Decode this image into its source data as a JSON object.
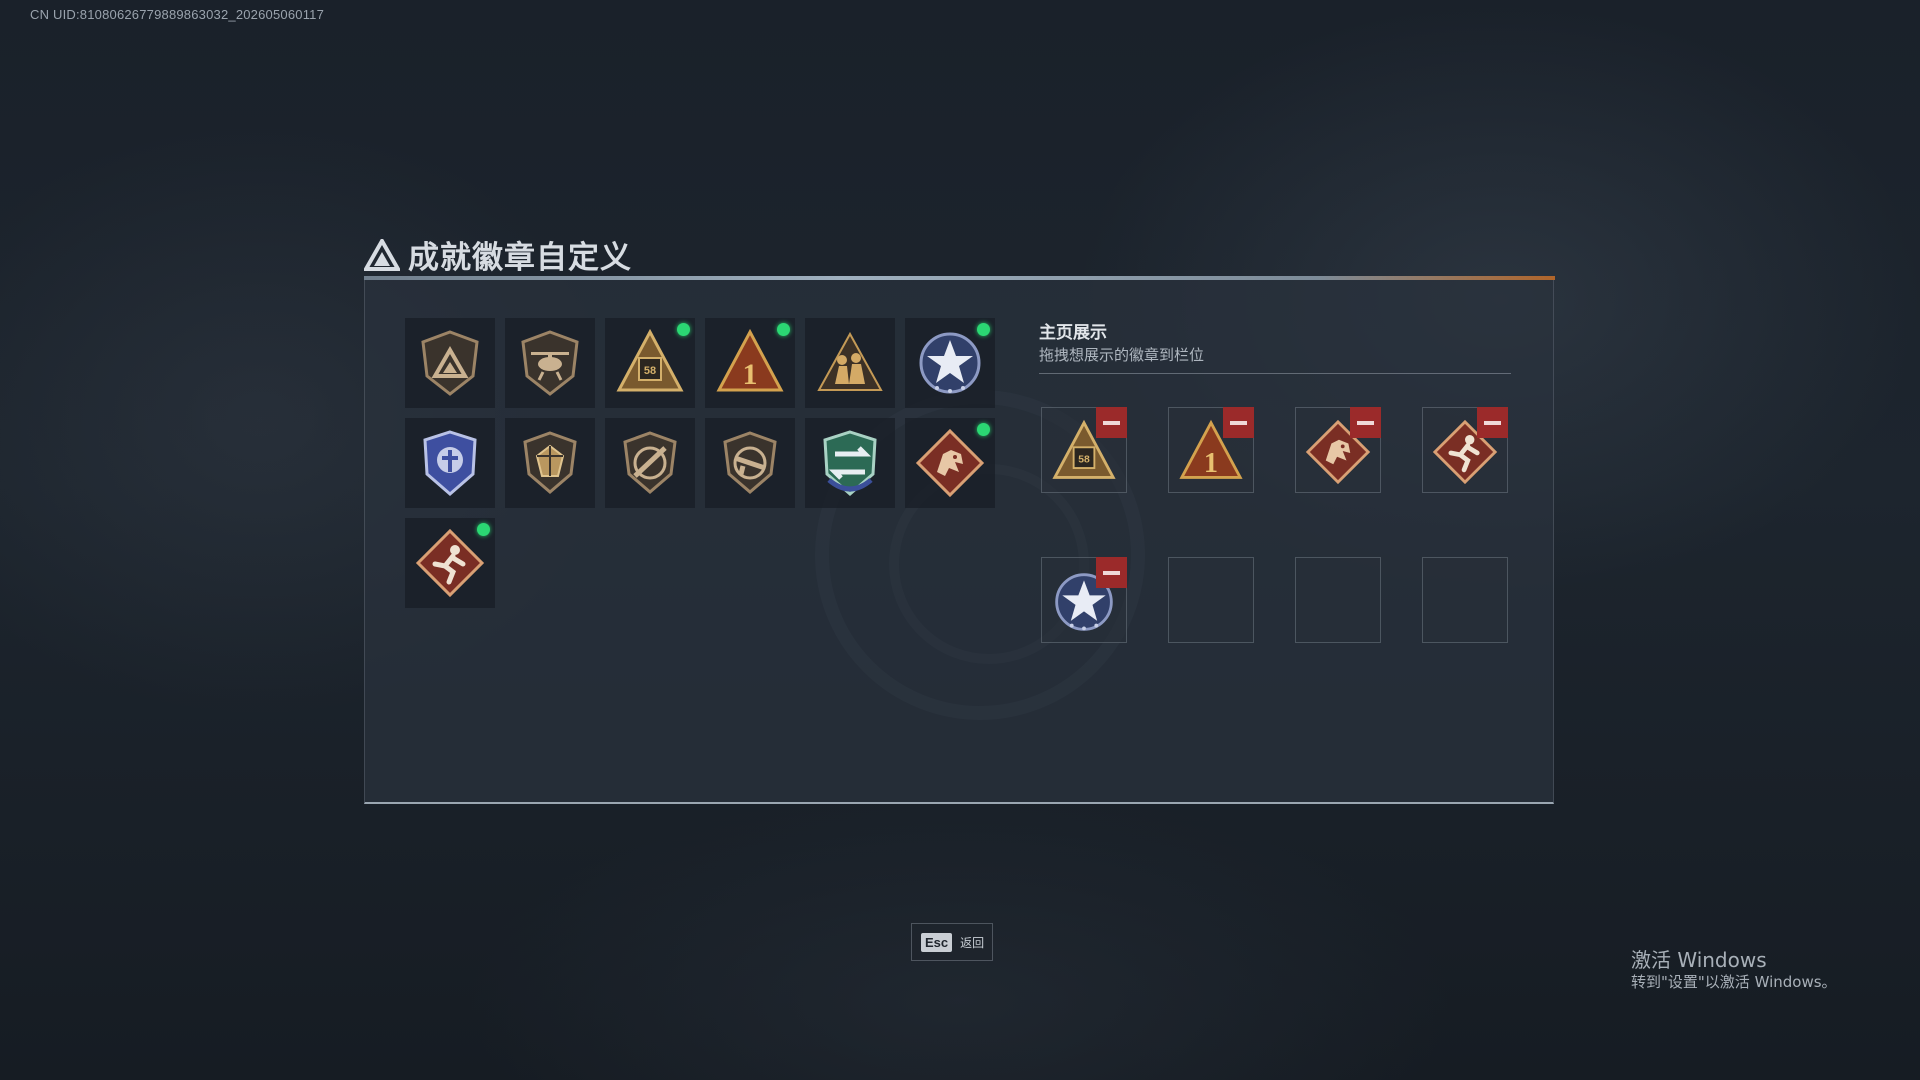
{
  "uid_text": "CN UID:8108062677988986303​2_202605060117",
  "page": {
    "title": "成就徽章自定义"
  },
  "owned_badges": [
    {
      "icon": "triangle-shield-badge-icon",
      "selected": false
    },
    {
      "icon": "helicopter-shield-badge-icon",
      "selected": false
    },
    {
      "icon": "vehicle-triangle-badge-icon",
      "selected": true
    },
    {
      "icon": "number-one-triangle-badge-icon",
      "selected": true
    },
    {
      "icon": "soldiers-triangle-badge-icon",
      "selected": false
    },
    {
      "icon": "star-globe-badge-icon",
      "selected": true
    },
    {
      "icon": "blue-eagle-shield-badge-icon",
      "selected": false
    },
    {
      "icon": "gem-shield-badge-icon",
      "selected": false
    },
    {
      "icon": "crossed-rifle-shield-badge-icon",
      "selected": false
    },
    {
      "icon": "rifle-shield-badge-icon",
      "selected": false
    },
    {
      "icon": "arrows-green-shield-badge-icon",
      "selected": false
    },
    {
      "icon": "dragon-diamond-badge-icon",
      "selected": true
    },
    {
      "icon": "runner-diamond-badge-icon",
      "selected": true
    }
  ],
  "showcase": {
    "title": "主页展示",
    "subtitle": "拖拽想展示的徽章到栏位",
    "slots": [
      {
        "icon": "vehicle-triangle-badge-icon"
      },
      {
        "icon": "number-one-triangle-badge-icon"
      },
      {
        "icon": "dragon-diamond-badge-icon"
      },
      {
        "icon": "runner-diamond-badge-icon"
      },
      {
        "icon": "star-globe-badge-icon"
      },
      {
        "icon": ""
      },
      {
        "icon": ""
      },
      {
        "icon": ""
      }
    ]
  },
  "footer": {
    "esc_key": "Esc",
    "esc_label": "返回"
  },
  "watermark": {
    "line1": "激活 Windows",
    "line2": "转到\"设置\"以激活 Windows。"
  },
  "colors": {
    "accent_green": "#2bd873",
    "remove_red": "#9b2a2a",
    "bronze": "#b58a55"
  }
}
